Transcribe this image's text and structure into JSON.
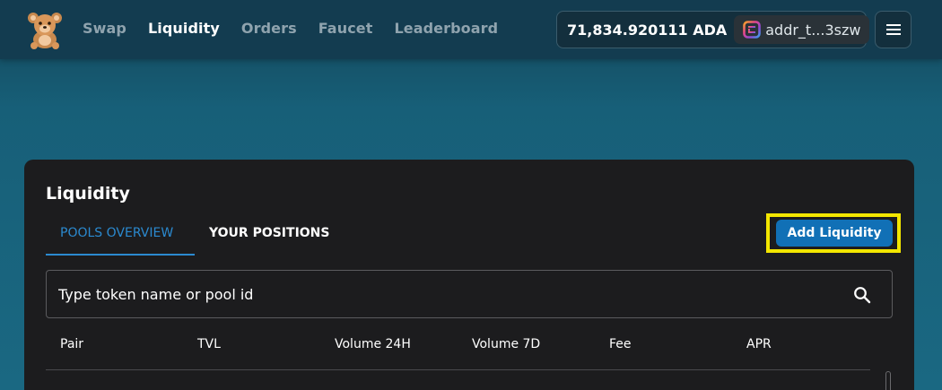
{
  "header": {
    "nav": [
      {
        "label": "Swap",
        "active": false
      },
      {
        "label": "Liquidity",
        "active": true
      },
      {
        "label": "Orders",
        "active": false
      },
      {
        "label": "Faucet",
        "active": false
      },
      {
        "label": "Leaderboard",
        "active": false
      }
    ],
    "wallet": {
      "balance": "71,834.920111 ADA",
      "address": "addr_t...3szw",
      "wallet_icon": "eternl-wallet-icon"
    },
    "logo_icon": "teddy-bear-logo",
    "menu_icon": "hamburger-menu-icon"
  },
  "liquidity": {
    "title": "Liquidity",
    "tabs": [
      {
        "label": "POOLS OVERVIEW",
        "active": true
      },
      {
        "label": "YOUR POSITIONS",
        "active": false
      }
    ],
    "add_button": "Add Liquidity",
    "search": {
      "placeholder": "Type token name or pool id",
      "value": ""
    },
    "columns": [
      "Pair",
      "TVL",
      "Volume 24H",
      "Volume 7D",
      "Fee",
      "APR"
    ]
  },
  "colors": {
    "header_bg": "#133c50",
    "page_bg": "#1a6882",
    "card_bg": "#1c1c1e",
    "accent": "#2b8ad0",
    "button": "#1170b6",
    "highlight": "#f3e600"
  }
}
